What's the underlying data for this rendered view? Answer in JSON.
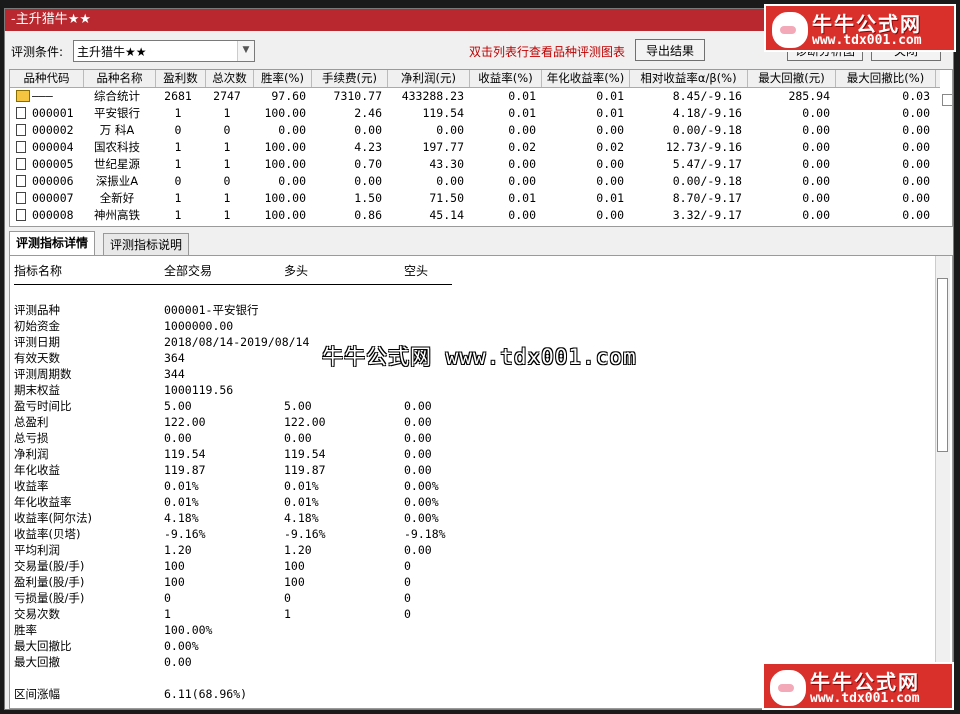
{
  "window": {
    "title": "-主升猎牛★★",
    "close": "×"
  },
  "toolbar": {
    "condition_label": "评测条件:",
    "condition_value": "主升猎牛★★",
    "hint": "双击列表行查看品种评测图表",
    "export_label": "导出结果",
    "chart_label": "诊断分析图",
    "close_label": "关闭"
  },
  "grid": {
    "headers": [
      "品种代码",
      "品种名称",
      "盈利数",
      "总次数",
      "胜率(%)",
      "手续费(元)",
      "净利润(元)",
      "收益率(%)",
      "年化收益率(%)",
      "相对收益率α/β(%)",
      "最大回撤(元)",
      "最大回撤比(%)"
    ],
    "rows": [
      {
        "code": "———",
        "name": "综合统计",
        "profit": "2681",
        "total": "2747",
        "win": "97.60",
        "fee": "7310.77",
        "net": "433288.23",
        "ret": "0.01",
        "annual": "0.01",
        "rel": "8.45/-9.16",
        "dd": "285.94",
        "ddr": "0.03",
        "summary": true
      },
      {
        "code": "000001",
        "name": "平安银行",
        "profit": "1",
        "total": "1",
        "win": "100.00",
        "fee": "2.46",
        "net": "119.54",
        "ret": "0.01",
        "annual": "0.01",
        "rel": "4.18/-9.16",
        "dd": "0.00",
        "ddr": "0.00"
      },
      {
        "code": "000002",
        "name": "万 科A",
        "profit": "0",
        "total": "0",
        "win": "0.00",
        "fee": "0.00",
        "net": "0.00",
        "ret": "0.00",
        "annual": "0.00",
        "rel": "0.00/-9.18",
        "dd": "0.00",
        "ddr": "0.00"
      },
      {
        "code": "000004",
        "name": "国农科技",
        "profit": "1",
        "total": "1",
        "win": "100.00",
        "fee": "4.23",
        "net": "197.77",
        "ret": "0.02",
        "annual": "0.02",
        "rel": "12.73/-9.16",
        "dd": "0.00",
        "ddr": "0.00"
      },
      {
        "code": "000005",
        "name": "世纪星源",
        "profit": "1",
        "total": "1",
        "win": "100.00",
        "fee": "0.70",
        "net": "43.30",
        "ret": "0.00",
        "annual": "0.00",
        "rel": "5.47/-9.17",
        "dd": "0.00",
        "ddr": "0.00"
      },
      {
        "code": "000006",
        "name": "深振业A",
        "profit": "0",
        "total": "0",
        "win": "0.00",
        "fee": "0.00",
        "net": "0.00",
        "ret": "0.00",
        "annual": "0.00",
        "rel": "0.00/-9.18",
        "dd": "0.00",
        "ddr": "0.00"
      },
      {
        "code": "000007",
        "name": "全新好",
        "profit": "1",
        "total": "1",
        "win": "100.00",
        "fee": "1.50",
        "net": "71.50",
        "ret": "0.01",
        "annual": "0.01",
        "rel": "8.70/-9.17",
        "dd": "0.00",
        "ddr": "0.00"
      },
      {
        "code": "000008",
        "name": "神州高铁",
        "profit": "1",
        "total": "1",
        "win": "100.00",
        "fee": "0.86",
        "net": "45.14",
        "ret": "0.00",
        "annual": "0.00",
        "rel": "3.32/-9.17",
        "dd": "0.00",
        "ddr": "0.00"
      }
    ]
  },
  "tabs": [
    {
      "label": "评测指标详情",
      "active": true
    },
    {
      "label": "评测指标说明",
      "active": false
    }
  ],
  "detail": {
    "headers": [
      "指标名称",
      "全部交易",
      "多头",
      "空头"
    ],
    "rows": [
      [
        "评测品种",
        "000001-平安银行",
        "",
        ""
      ],
      [
        "初始资金",
        "1000000.00",
        "",
        ""
      ],
      [
        "评测日期",
        "2018/08/14-2019/08/14",
        "",
        ""
      ],
      [
        "有效天数",
        "364",
        "",
        ""
      ],
      [
        "评测周期数",
        "344",
        "",
        ""
      ],
      [
        "期末权益",
        "1000119.56",
        "",
        ""
      ],
      [
        "盈亏时间比",
        "5.00",
        "5.00",
        "0.00"
      ],
      [
        "总盈利",
        "122.00",
        "122.00",
        "0.00"
      ],
      [
        "总亏损",
        "0.00",
        "0.00",
        "0.00"
      ],
      [
        "净利润",
        "119.54",
        "119.54",
        "0.00"
      ],
      [
        "年化收益",
        "119.87",
        "119.87",
        "0.00"
      ],
      [
        "收益率",
        "0.01%",
        "0.01%",
        "0.00%"
      ],
      [
        "年化收益率",
        "0.01%",
        "0.01%",
        "0.00%"
      ],
      [
        "收益率(阿尔法)",
        "4.18%",
        "4.18%",
        "0.00%"
      ],
      [
        "收益率(贝塔)",
        "-9.16%",
        "-9.16%",
        "-9.18%"
      ],
      [
        "平均利润",
        "1.20",
        "1.20",
        "0.00"
      ],
      [
        "交易量(股/手)",
        "100",
        "100",
        "0"
      ],
      [
        "盈利量(股/手)",
        "100",
        "100",
        "0"
      ],
      [
        "亏损量(股/手)",
        "0",
        "0",
        "0"
      ],
      [
        "交易次数",
        "1",
        "1",
        "0"
      ],
      [
        "胜率",
        "100.00%",
        "",
        ""
      ],
      [
        "最大回撤比",
        "0.00%",
        "",
        ""
      ],
      [
        "最大回撤",
        "0.00",
        "",
        ""
      ],
      [
        "",
        "",
        "",
        ""
      ],
      [
        "区间涨幅",
        "6.11(68.96%)",
        "",
        ""
      ]
    ]
  },
  "watermark": {
    "center": "牛牛公式网 www.tdx001.com",
    "logo_title": "牛牛公式网",
    "logo_url": "www.tdx001.com"
  }
}
